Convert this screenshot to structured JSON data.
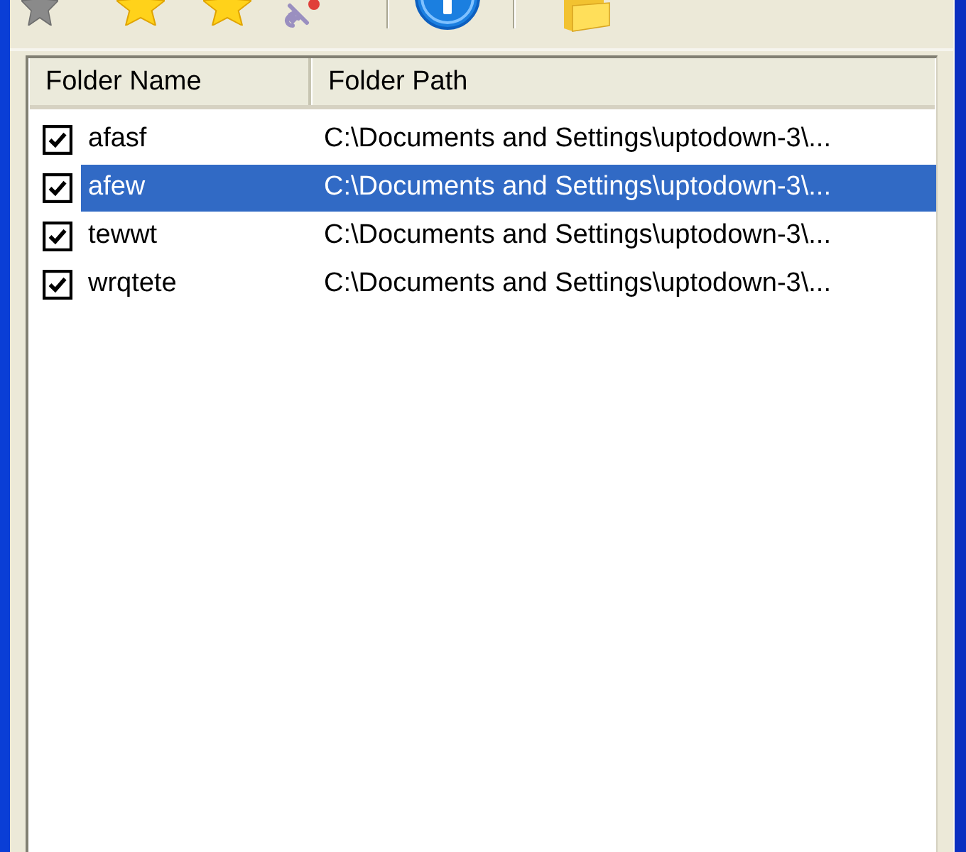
{
  "list": {
    "columns": [
      "Folder Name",
      "Folder Path"
    ],
    "rows": [
      {
        "name": "afasf",
        "path": "C:\\Documents and Settings\\uptodown-3\\...",
        "checked": true,
        "selected": false
      },
      {
        "name": "afew",
        "path": "C:\\Documents and Settings\\uptodown-3\\...",
        "checked": true,
        "selected": true
      },
      {
        "name": "tewwt",
        "path": "C:\\Documents and Settings\\uptodown-3\\...",
        "checked": true,
        "selected": false
      },
      {
        "name": "wrqtete",
        "path": "C:\\Documents and Settings\\uptodown-3\\...",
        "checked": true,
        "selected": false
      }
    ]
  }
}
